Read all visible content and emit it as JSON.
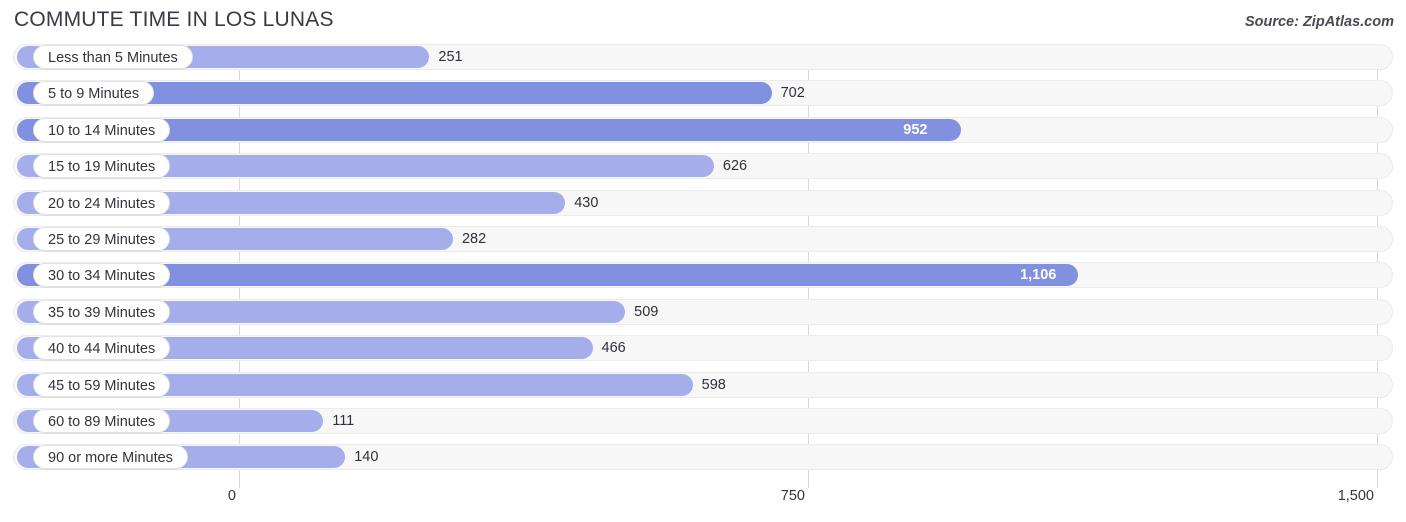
{
  "header": {
    "title": "COMMUTE TIME IN LOS LUNAS",
    "source": "Source: ZipAtlas.com"
  },
  "colors": {
    "bar_light": "#a5aeea",
    "bar_dark": "#8290e0",
    "track": "#f7f7f7",
    "gridline": "#d9d9d9",
    "text": "#33333c",
    "value_inside": "#ffffff"
  },
  "chart_data": {
    "type": "bar",
    "orientation": "horizontal",
    "title": "COMMUTE TIME IN LOS LUNAS",
    "xlabel": "",
    "ylabel": "",
    "xlim": [
      0,
      1500
    ],
    "xticks": [
      0,
      750,
      1500
    ],
    "xtick_labels": [
      "0",
      "750",
      "1,500"
    ],
    "grid": true,
    "legend": null,
    "categories": [
      "Less than 5 Minutes",
      "5 to 9 Minutes",
      "10 to 14 Minutes",
      "15 to 19 Minutes",
      "20 to 24 Minutes",
      "25 to 29 Minutes",
      "30 to 34 Minutes",
      "35 to 39 Minutes",
      "40 to 44 Minutes",
      "45 to 59 Minutes",
      "60 to 89 Minutes",
      "90 or more Minutes"
    ],
    "values": [
      251,
      702,
      952,
      626,
      430,
      282,
      1106,
      509,
      466,
      598,
      111,
      140
    ],
    "value_labels": [
      "251",
      "702",
      "952",
      "626",
      "430",
      "282",
      "1,106",
      "509",
      "466",
      "598",
      "111",
      "140"
    ]
  },
  "rows": [
    {
      "label": "Less than 5 Minutes",
      "value": 251,
      "value_label": "251",
      "shade": "light",
      "label_inside": false
    },
    {
      "label": "5 to 9 Minutes",
      "value": 702,
      "value_label": "702",
      "shade": "dark",
      "label_inside": false
    },
    {
      "label": "10 to 14 Minutes",
      "value": 952,
      "value_label": "952",
      "shade": "dark",
      "label_inside": true
    },
    {
      "label": "15 to 19 Minutes",
      "value": 626,
      "value_label": "626",
      "shade": "light",
      "label_inside": false
    },
    {
      "label": "20 to 24 Minutes",
      "value": 430,
      "value_label": "430",
      "shade": "light",
      "label_inside": false
    },
    {
      "label": "25 to 29 Minutes",
      "value": 282,
      "value_label": "282",
      "shade": "light",
      "label_inside": false
    },
    {
      "label": "30 to 34 Minutes",
      "value": 1106,
      "value_label": "1,106",
      "shade": "dark",
      "label_inside": true
    },
    {
      "label": "35 to 39 Minutes",
      "value": 509,
      "value_label": "509",
      "shade": "light",
      "label_inside": false
    },
    {
      "label": "40 to 44 Minutes",
      "value": 466,
      "value_label": "466",
      "shade": "light",
      "label_inside": false
    },
    {
      "label": "45 to 59 Minutes",
      "value": 598,
      "value_label": "598",
      "shade": "light",
      "label_inside": false
    },
    {
      "label": "60 to 89 Minutes",
      "value": 111,
      "value_label": "111",
      "shade": "light",
      "label_inside": false
    },
    {
      "label": "90 or more Minutes",
      "value": 140,
      "value_label": "140",
      "shade": "light",
      "label_inside": false
    }
  ],
  "axis": {
    "ticks": [
      {
        "label": "0",
        "value": 0
      },
      {
        "label": "750",
        "value": 750
      },
      {
        "label": "1,500",
        "value": 1500
      }
    ]
  }
}
